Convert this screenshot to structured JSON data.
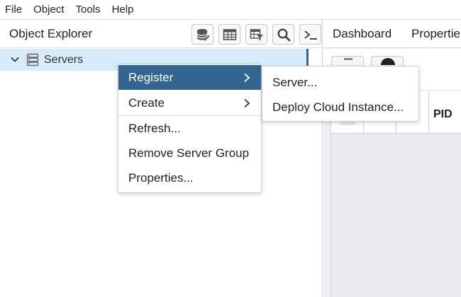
{
  "menubar": {
    "items": [
      "File",
      "Object",
      "Tools",
      "Help"
    ]
  },
  "object_explorer": {
    "title": "Object Explorer",
    "toolbar_icons": [
      "database-icon",
      "table-icon",
      "filter-table-icon",
      "search-icon",
      "terminal-icon"
    ],
    "tree": {
      "root_label": "Servers",
      "expanded": true
    }
  },
  "right_panel": {
    "tabs": [
      "Dashboard",
      "Propertie"
    ],
    "grid_header": {
      "pid_label": "PID"
    }
  },
  "context_menu": {
    "items": [
      {
        "label": "Register",
        "has_submenu": true,
        "active": true
      },
      {
        "label": "Create",
        "has_submenu": true,
        "active": false
      },
      {
        "label": "Refresh...",
        "has_submenu": false,
        "active": false
      },
      {
        "label": "Remove Server Group",
        "has_submenu": false,
        "active": false
      },
      {
        "label": "Properties...",
        "has_submenu": false,
        "active": false
      }
    ]
  },
  "submenu": {
    "items": [
      "Server...",
      "Deploy Cloud Instance..."
    ]
  },
  "colors": {
    "accent": "#326690",
    "selected_row": "#d6ecfa",
    "panel_bg": "#eef0f4"
  }
}
